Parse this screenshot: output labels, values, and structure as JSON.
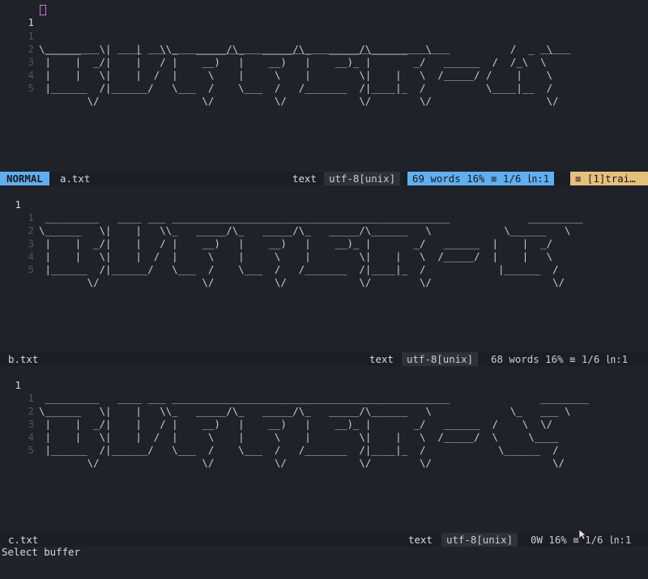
{
  "panes": [
    {
      "lines": [
        {
          "num": "1",
          "text": " _________   ____ ___ ______________________________________________               _____"
        },
        {
          "num": "1",
          "text": "\\______   \\|    |   \\\\_   _____/\\_   _____/\\_   _____/\\______   \\             /  _  \\"
        },
        {
          "num": "2",
          "text": " |    |  _/|    |   / |    __)   |    __)   |    __)_ |       _/   ______  /  /_\\  \\"
        },
        {
          "num": "3",
          "text": " |    |   \\|    |  /  |     \\    |     \\    |        \\|    |   \\  /_____/ /    |    \\"
        },
        {
          "num": "4",
          "text": " |______  /|______/   \\___  /    \\___  /   /_______  /|____|_  /          \\____|__  /"
        },
        {
          "num": "5",
          "text": "        \\/                 \\/          \\/            \\/        \\/                   \\/"
        }
      ],
      "status": {
        "mode": "NORMAL",
        "file": "a.txt",
        "filetype": "text",
        "encoding": "utf-8[unix]",
        "stats": "69 words 16% ≡ 1/6 ㏑:1",
        "warning": "≡ [1]trai…"
      }
    },
    {
      "lines": [
        {
          "num": "1",
          "text": " _________   ____ ___ ______________________________________________             _________"
        },
        {
          "num": "1",
          "text": "\\______   \\|    |   \\\\_   _____/\\_   _____/\\_   _____/\\______   \\            \\______   \\"
        },
        {
          "num": "2",
          "text": " |    |  _/|    |   / |    __)   |    __)   |    __)_ |       _/   ______  |    |  _/"
        },
        {
          "num": "3",
          "text": " |    |   \\|    |  /  |     \\    |     \\    |        \\|    |   \\  /_____/  |    |   \\"
        },
        {
          "num": "4",
          "text": " |______  /|______/   \\___  /    \\___  /   /_______  /|____|_  /            |______  /"
        },
        {
          "num": "5",
          "text": "        \\/                 \\/          \\/            \\/        \\/                    \\/"
        }
      ],
      "status": {
        "file": "b.txt",
        "filetype": "text",
        "encoding": "utf-8[unix]",
        "stats": "68 words 16% ≡ 1/6 ㏑:1"
      }
    },
    {
      "lines": [
        {
          "num": "1",
          "text": " _________   ____ ___ ______________________________________________               ________"
        },
        {
          "num": "1",
          "text": "\\______   \\|    |   \\\\_   _____/\\_   _____/\\_   _____/\\______   \\             \\_   ___ \\"
        },
        {
          "num": "2",
          "text": " |    |  _/|    |   / |    __)   |    __)   |    __)_ |       _/   ______  /    \\  \\/"
        },
        {
          "num": "3",
          "text": " |    |   \\|    |  /  |     \\    |     \\    |        \\|    |   \\  /_____/  \\     \\____"
        },
        {
          "num": "4",
          "text": " |______  /|______/   \\___  /    \\___  /   /_______  /|____|_  /            \\______  /"
        },
        {
          "num": "5",
          "text": "        \\/                 \\/          \\/            \\/        \\/                    \\/"
        }
      ],
      "status": {
        "file": "c.txt",
        "filetype": "text",
        "encoding": "utf-8[unix]",
        "stats": "0W 16% ≡ 1/6 ㏑:1"
      }
    }
  ],
  "cmdline": "Select buffer",
  "colors": {
    "accent": "#61afef",
    "warning": "#e5c07b",
    "cursor": "#c678dd",
    "background": "#1f2229"
  },
  "icons": [
    "mouse-pointer-icon"
  ]
}
